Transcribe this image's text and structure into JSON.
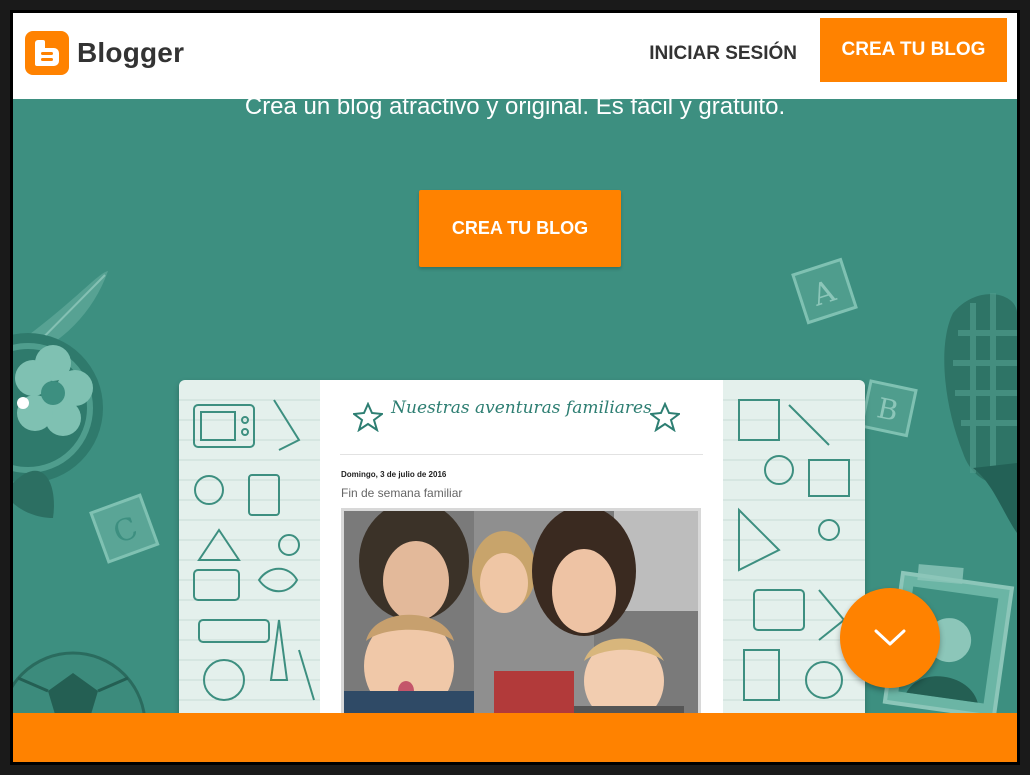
{
  "header": {
    "logo_text": "Blogger",
    "login_label": "INICIAR SESIÓN",
    "cta_label": "CREA TU BLOG"
  },
  "hero": {
    "subtitle": "Crea un blog atractivo y original. Es fácil y gratuito.",
    "cta_label": "CREA TU BLOG"
  },
  "preview": {
    "blog_title": "Nuestras aventuras familiares",
    "post_date": "Domingo, 3 de julio de 2016",
    "post_title": "Fin de semana familiar"
  },
  "icons": {
    "logo": "blogger-logo-icon",
    "scroll": "chevron-down-icon",
    "star": "star-icon"
  },
  "colors": {
    "brand": "#ff8200",
    "hero_bg": "#3d8f80",
    "accent_text": "#2d7e72"
  }
}
